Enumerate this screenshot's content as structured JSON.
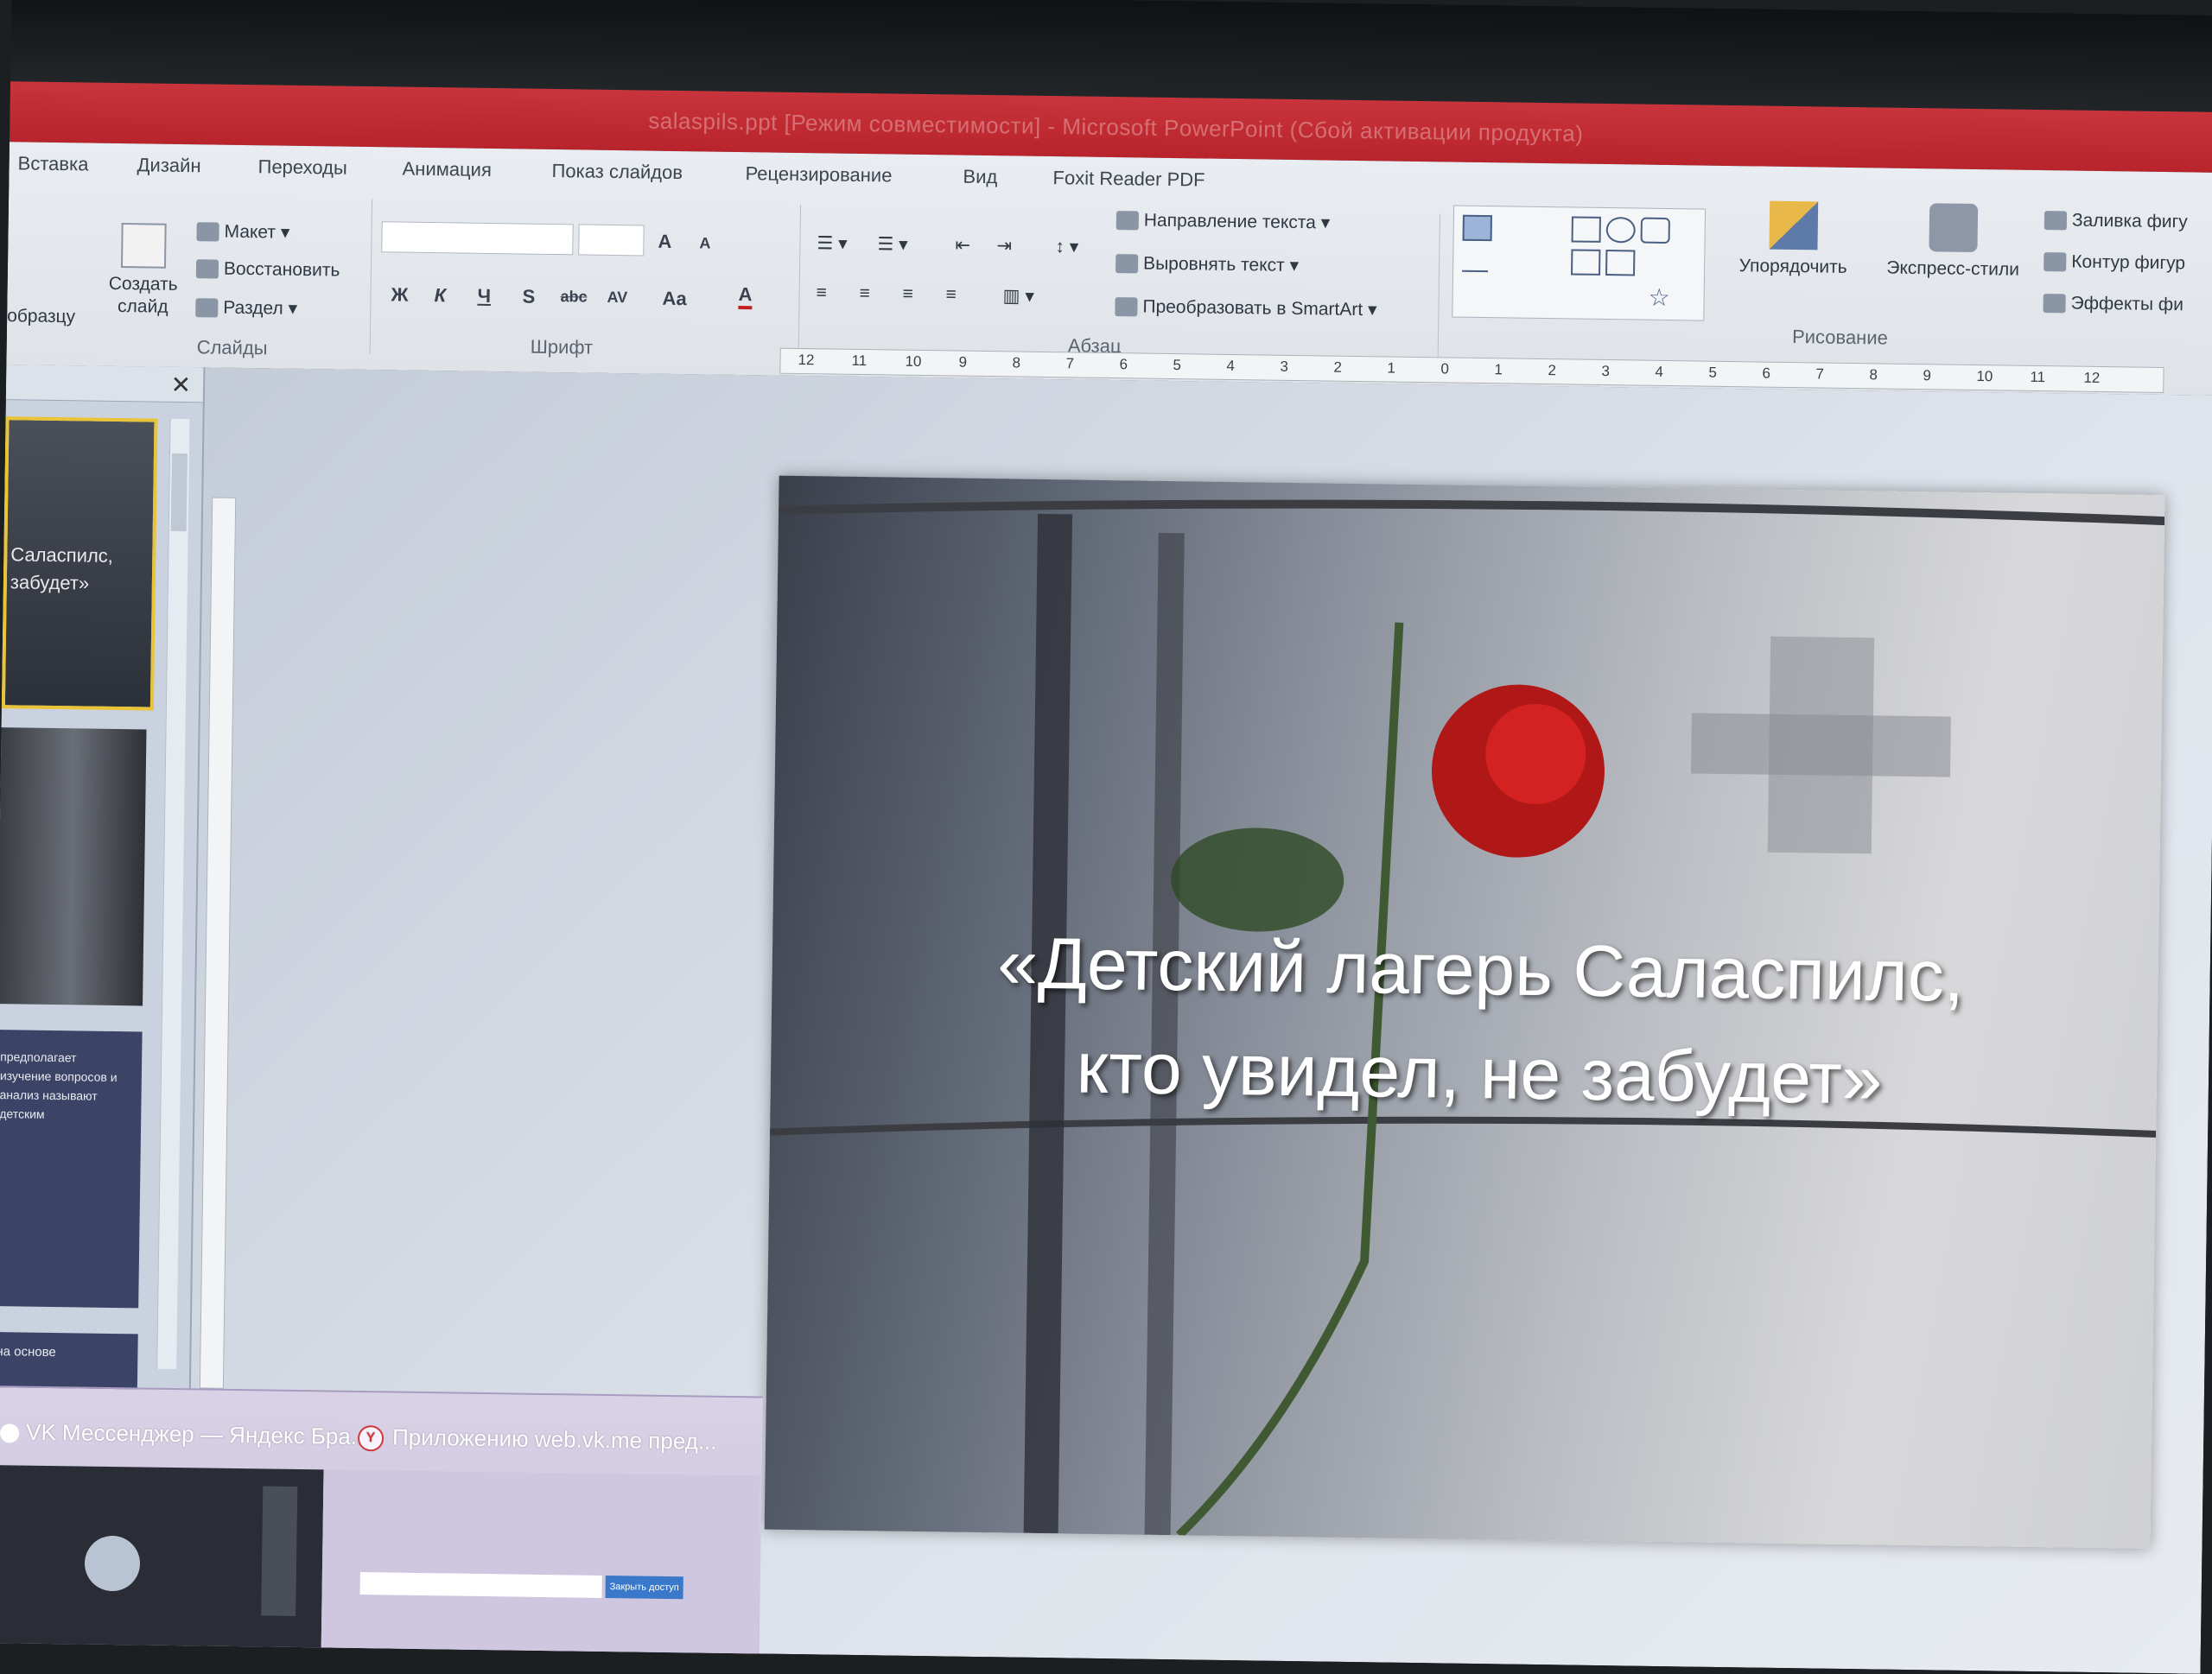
{
  "window": {
    "title": "salaspils.ppt [Режим совместимости] - Microsoft PowerPoint (Сбой активации продукта)"
  },
  "ribbon": {
    "tabs": [
      "Вставка",
      "Дизайн",
      "Переходы",
      "Анимация",
      "Показ слайдов",
      "Рецензирование",
      "Вид",
      "Foxit Reader PDF"
    ],
    "clipboard": {
      "format_painter": "образцу"
    },
    "slides_group": {
      "label": "Слайды",
      "new_slide": "Создать слайд",
      "layout": "Макет",
      "reset": "Восстановить",
      "section": "Раздел"
    },
    "font_group": {
      "label": "Шрифт",
      "bold": "Ж",
      "italic": "К",
      "underline": "Ч",
      "shadow": "S",
      "strike": "abc",
      "spacing": "AV",
      "case": "Aa",
      "color": "A",
      "grow": "A",
      "shrink": "A"
    },
    "paragraph_group": {
      "label": "Абзац",
      "text_direction": "Направление текста",
      "align_text": "Выровнять текст",
      "smartart": "Преобразовать в SmartArt"
    },
    "drawing_group": {
      "label": "Рисование",
      "arrange": "Упорядочить",
      "quick_styles": "Экспресс-стили",
      "shape_fill": "Заливка фигу",
      "shape_outline": "Контур фигур",
      "shape_effects": "Эффекты фи"
    }
  },
  "ruler": {
    "ticks": [
      "12",
      "11",
      "10",
      "9",
      "8",
      "7",
      "6",
      "5",
      "4",
      "3",
      "2",
      "1",
      "0",
      "1",
      "2",
      "3",
      "4",
      "5",
      "6",
      "7",
      "8",
      "9",
      "10",
      "11",
      "12"
    ]
  },
  "slide_panel": {
    "thumb1_text": "Саласпилс, забудет»",
    "thumb3_text": "предполагает изучение вопросов и анализ называют детским",
    "thumb4_text": "на основе"
  },
  "slide": {
    "title_line1": "«Детский лагерь Саласпилс,",
    "title_line2": "кто увидел, не забудет»"
  },
  "taskbar_preview": {
    "item1_title": "VK Мессенджер — Яндекс Бра...",
    "item2_title": "Приложению web.vk.me пред...",
    "item2_button": "Закрыть доступ"
  }
}
